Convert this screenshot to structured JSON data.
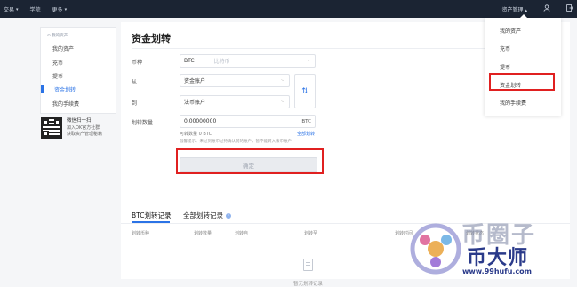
{
  "topbar": {
    "nav": [
      "交易",
      "学院",
      "更多"
    ],
    "asset_management": "资产管理",
    "user_icon": "user-icon",
    "logout_icon": "logout-icon"
  },
  "sidebar": {
    "group_label": "我的资产",
    "items": [
      {
        "label": "我的资产",
        "active": false
      },
      {
        "label": "充币",
        "active": false
      },
      {
        "label": "提币",
        "active": false
      },
      {
        "label": "资金划转",
        "active": true
      },
      {
        "label": "我的手续费",
        "active": false
      }
    ]
  },
  "qr": {
    "title": "微信扫一扫",
    "line1": "加入OK官方社群",
    "line2": "获取资产管理秘籍"
  },
  "main": {
    "title": "资金划转",
    "currency_label": "币种",
    "currency_value": "BTC",
    "currency_name": "比特币",
    "from_label": "从",
    "from_value": "资金账户",
    "to_label": "到",
    "to_value": "法币账户",
    "amount_label": "划转数量",
    "amount_value": "0.00000000",
    "amount_unit": "BTC",
    "available_label": "可转数量",
    "available_value": "0 BTC",
    "transfer_all": "全部划转",
    "hint": "温馨提示：未过到账币过持确认前的账户，暂不能转入法币账户",
    "confirm_label": "确定"
  },
  "records": {
    "tab_btc": "BTC划转记录",
    "tab_all": "全部划转记录",
    "columns": [
      "划转币种",
      "划转数量",
      "划转自",
      "划转至",
      "划转时间",
      "划转状态"
    ],
    "empty_text": "暂无划转记录"
  },
  "dropdown": {
    "items": [
      "我的资产",
      "充币",
      "提币",
      "资金划转",
      "我的手续费"
    ]
  },
  "watermark": {
    "text": "币圈子",
    "brand": "币大师",
    "url": "www.99hufu.com"
  },
  "colors": {
    "accent": "#2b73e6",
    "highlight_red": "#e02020",
    "topbar": "#1b2433"
  }
}
